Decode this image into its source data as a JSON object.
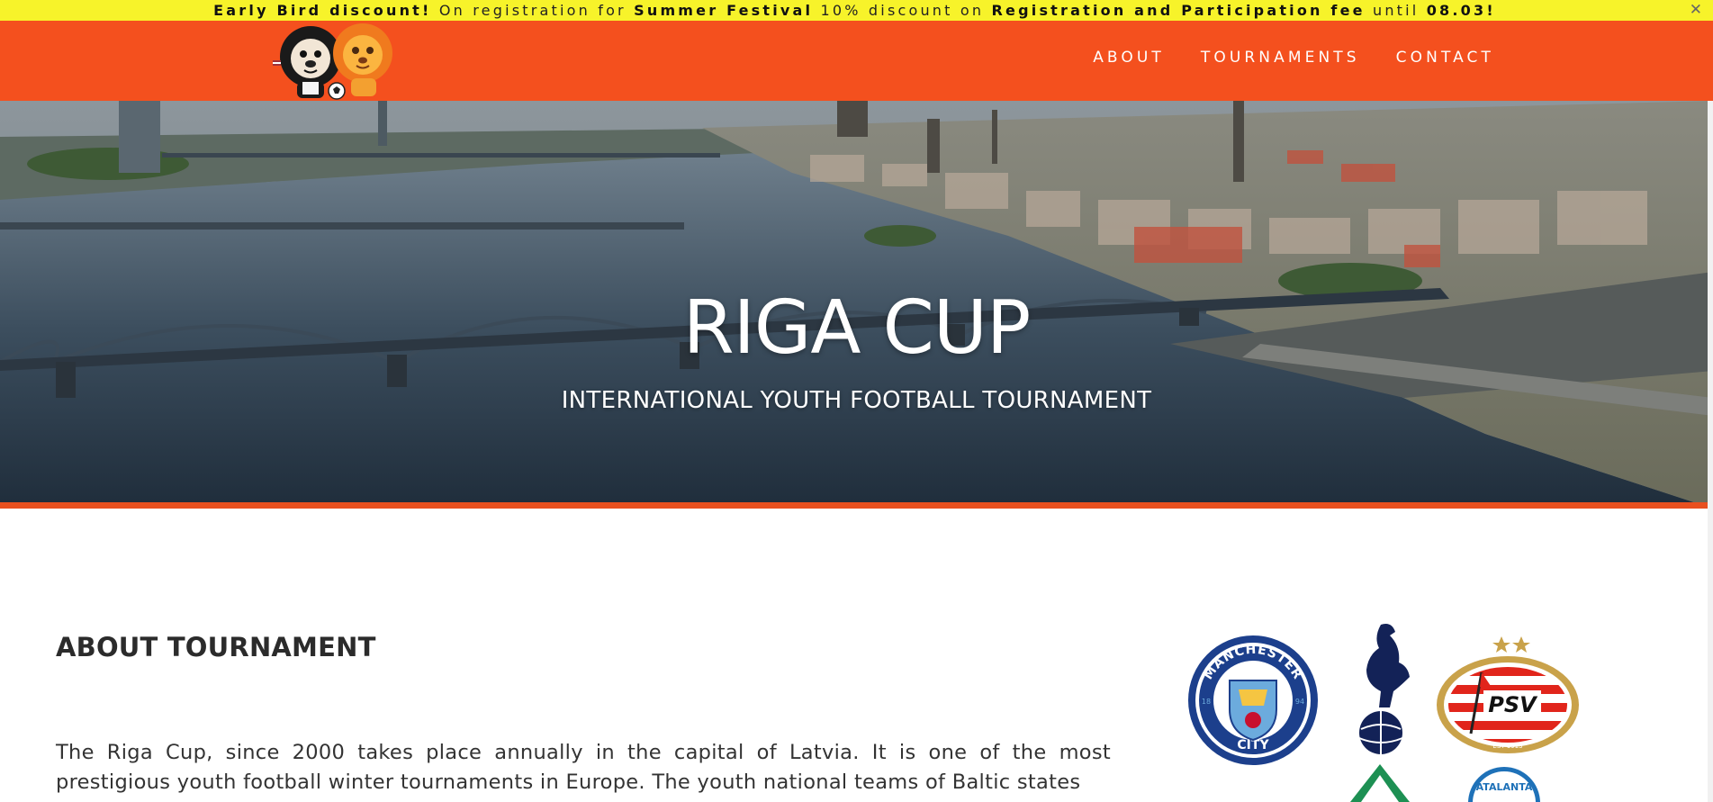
{
  "promo": {
    "part1": "Early Bird discount!",
    "part2": " On registration for ",
    "part3": "Summer Festival",
    "part4": " 10% discount on ",
    "part5": "Registration and Participation fee",
    "part6": " until ",
    "part7": "08.03!",
    "close": "✕",
    "bg_color": "#f7f32a"
  },
  "header": {
    "bg_color": "#f4501e",
    "logo_icon": "lion-mascots-logo",
    "nav": [
      {
        "label": "ABOUT"
      },
      {
        "label": "TOURNAMENTS"
      },
      {
        "label": "CONTACT"
      }
    ]
  },
  "hero": {
    "title": "RIGA CUP",
    "subtitle": "INTERNATIONAL YOUTH FOOTBALL TOURNAMENT",
    "image": "riga-river-bridges-aerial"
  },
  "about": {
    "title": "ABOUT TOURNAMENT",
    "text": "The Riga Cup, since 2000 takes place annually in the capital of Latvia. It is one of the most prestigious youth football winter tournaments in Europe. The youth national teams of Baltic states"
  },
  "clubs": [
    {
      "name": "manchester-city-badge",
      "top_text": "MANCHESTER",
      "bottom_text": "CITY",
      "left_num": "18",
      "right_num": "94"
    },
    {
      "name": "tottenham-badge"
    },
    {
      "name": "psv-badge",
      "text": "PSV",
      "est": "EST 1913"
    },
    {
      "name": "werder-badge"
    },
    {
      "name": "atalanta-badge",
      "text": "ATALANTA"
    }
  ]
}
